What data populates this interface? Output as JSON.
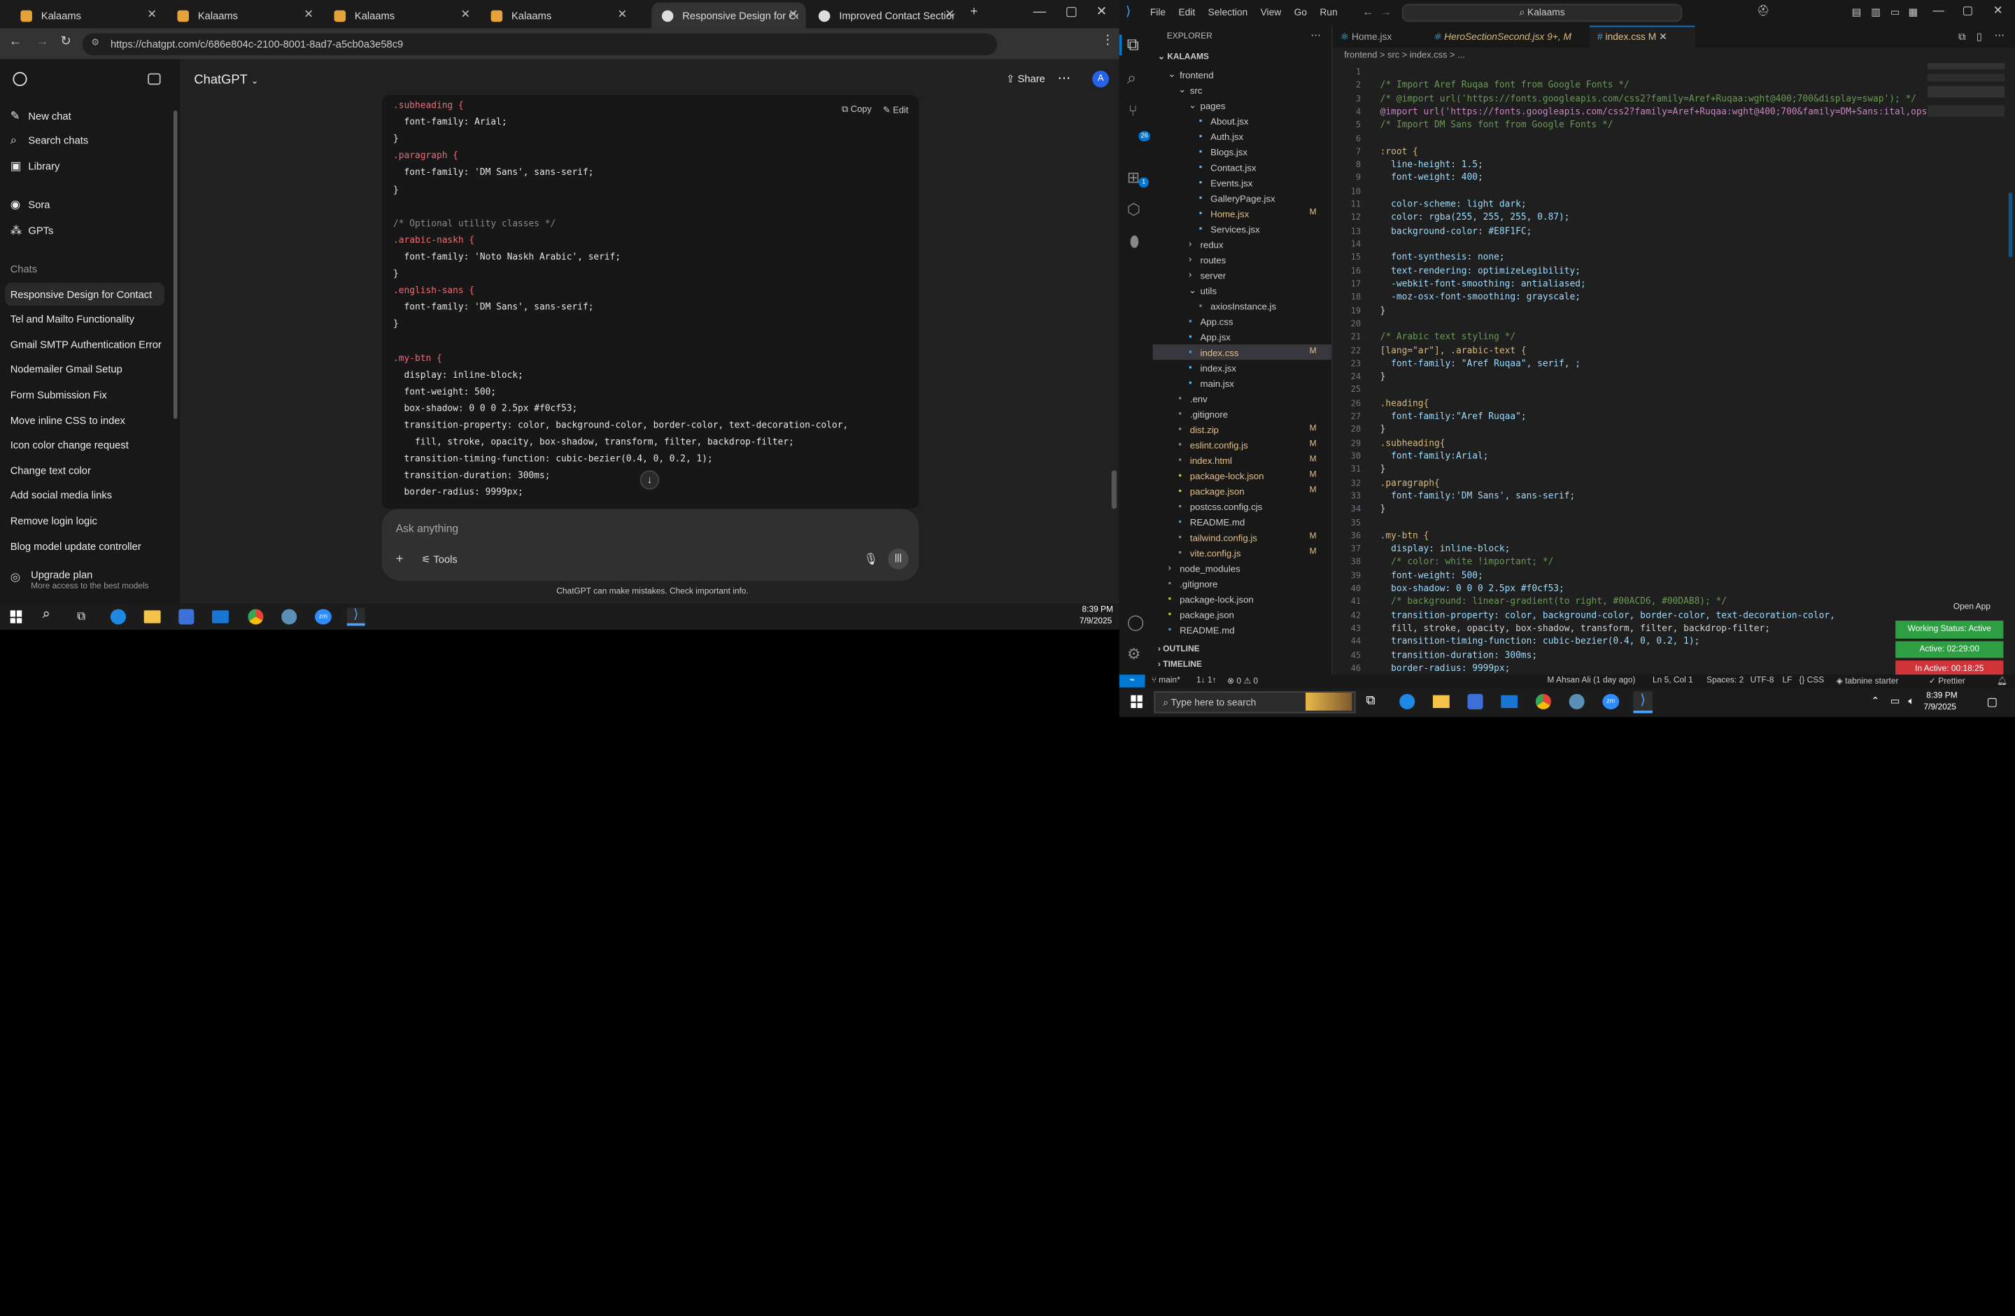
{
  "browser": {
    "tabs": [
      {
        "label": "Kalaams"
      },
      {
        "label": "Kalaams"
      },
      {
        "label": "Kalaams"
      },
      {
        "label": "Kalaams"
      },
      {
        "label": "Responsive Design for Conta"
      },
      {
        "label": "Improved Contact Section St"
      }
    ],
    "url": "https://chatgpt.com/c/686e804c-2100-8001-8ad7-a5cb0a3e58c9"
  },
  "chatgpt": {
    "brand": "ChatGPT",
    "share_label": "Share",
    "avatar": "A",
    "nav": [
      {
        "label": "New chat"
      },
      {
        "label": "Search chats"
      },
      {
        "label": "Library"
      },
      {
        "label": "Sora"
      },
      {
        "label": "GPTs"
      }
    ],
    "chats_heading": "Chats",
    "chats": [
      "Responsive Design for Contact",
      "Tel and Mailto Functionality",
      "Gmail SMTP Authentication Error",
      "Nodemailer Gmail Setup",
      "Form Submission Fix",
      "Move inline CSS to index",
      "Icon color change request",
      "Change text color",
      "Add social media links",
      "Remove login logic",
      "Blog model update controller"
    ],
    "upgrade_title": "Upgrade plan",
    "upgrade_sub": "More access to the best models",
    "copy_label": "Copy",
    "edit_label": "Edit",
    "ask_placeholder": "Ask anything",
    "tools_label": "Tools",
    "disclaimer": "ChatGPT can make mistakes. Check important info."
  },
  "code_lines": [
    ".subheading {",
    "  font-family: Arial;",
    "}",
    ".paragraph {",
    "  font-family: 'DM Sans', sans-serif;",
    "}",
    "",
    "/* Optional utility classes */",
    ".arabic-naskh {",
    "  font-family: 'Noto Naskh Arabic', serif;",
    "}",
    ".english-sans {",
    "  font-family: 'DM Sans', sans-serif;",
    "}",
    "",
    ".my-btn {",
    "  display: inline-block;",
    "  font-weight: 500;",
    "  box-shadow: 0 0 0 2.5px #f0cf53;",
    "  transition-property: color, background-color, border-color, text-decoration-color,",
    "    fill, stroke, opacity, box-shadow, transform, filter, backdrop-filter;",
    "  transition-timing-function: cubic-bezier(0.4, 0, 0.2, 1);",
    "  transition-duration: 300ms;",
    "  border-radius: 9999px;"
  ],
  "taskbar_left": {
    "time": "8:39 PM",
    "date": "7/9/2025"
  },
  "vscode": {
    "menu": [
      "File",
      "Edit",
      "Selection",
      "View",
      "Go",
      "Run"
    ],
    "search": "Kalaams",
    "tabs": [
      {
        "label": "Home.jsx"
      },
      {
        "label": "HeroSectionSecond.jsx",
        "status": "9+, M"
      },
      {
        "label": "index.css",
        "status": "M"
      }
    ],
    "breadcrumb": "frontend > src > index.css > ...",
    "explorer_title": "EXPLORER",
    "root": "KALAAMS",
    "tree": [
      {
        "label": "frontend",
        "indent": 1,
        "type": "folder-open"
      },
      {
        "label": "src",
        "indent": 2,
        "type": "folder-open"
      },
      {
        "label": "pages",
        "indent": 3,
        "type": "folder-open"
      },
      {
        "label": "About.jsx",
        "indent": 4,
        "type": "file"
      },
      {
        "label": "Auth.jsx",
        "indent": 4,
        "type": "file"
      },
      {
        "label": "Blogs.jsx",
        "indent": 4,
        "type": "file"
      },
      {
        "label": "Contact.jsx",
        "indent": 4,
        "type": "file"
      },
      {
        "label": "Events.jsx",
        "indent": 4,
        "type": "file"
      },
      {
        "label": "GalleryPage.jsx",
        "indent": 4,
        "type": "file"
      },
      {
        "label": "Home.jsx",
        "indent": 4,
        "type": "file",
        "badge": "M"
      },
      {
        "label": "Services.jsx",
        "indent": 4,
        "type": "file"
      },
      {
        "label": "redux",
        "indent": 3,
        "type": "folder"
      },
      {
        "label": "routes",
        "indent": 3,
        "type": "folder"
      },
      {
        "label": "server",
        "indent": 3,
        "type": "folder"
      },
      {
        "label": "utils",
        "indent": 3,
        "type": "folder-open"
      },
      {
        "label": "axiosInstance.js",
        "indent": 4,
        "type": "file"
      },
      {
        "label": "App.css",
        "indent": 3,
        "type": "file"
      },
      {
        "label": "App.jsx",
        "indent": 3,
        "type": "file"
      },
      {
        "label": "index.css",
        "indent": 3,
        "type": "file",
        "badge": "M",
        "selected": true
      },
      {
        "label": "index.jsx",
        "indent": 3,
        "type": "file"
      },
      {
        "label": "main.jsx",
        "indent": 3,
        "type": "file"
      },
      {
        "label": ".env",
        "indent": 2,
        "type": "file"
      },
      {
        "label": ".gitignore",
        "indent": 2,
        "type": "file"
      },
      {
        "label": "dist.zip",
        "indent": 2,
        "type": "file",
        "badge": "M"
      },
      {
        "label": "eslint.config.js",
        "indent": 2,
        "type": "file",
        "badge": "M"
      },
      {
        "label": "index.html",
        "indent": 2,
        "type": "file",
        "badge": "M"
      },
      {
        "label": "package-lock.json",
        "indent": 2,
        "type": "file",
        "badge": "M"
      },
      {
        "label": "package.json",
        "indent": 2,
        "type": "file",
        "badge": "M"
      },
      {
        "label": "postcss.config.cjs",
        "indent": 2,
        "type": "file"
      },
      {
        "label": "README.md",
        "indent": 2,
        "type": "file"
      },
      {
        "label": "tailwind.config.js",
        "indent": 2,
        "type": "file",
        "badge": "M"
      },
      {
        "label": "vite.config.js",
        "indent": 2,
        "type": "file",
        "badge": "M"
      },
      {
        "label": "node_modules",
        "indent": 1,
        "type": "folder"
      },
      {
        "label": ".gitignore",
        "indent": 1,
        "type": "file"
      },
      {
        "label": "package-lock.json",
        "indent": 1,
        "type": "file"
      },
      {
        "label": "package.json",
        "indent": 1,
        "type": "file"
      },
      {
        "label": "README.md",
        "indent": 1,
        "type": "file"
      }
    ],
    "outline": "OUTLINE",
    "timeline": "TIMELINE",
    "editor_lines": [
      {
        "n": 1,
        "t": ""
      },
      {
        "n": 2,
        "t": "/* Import Aref Ruqaa font from Google Fonts */"
      },
      {
        "n": 3,
        "t": "/* @import url('https://fonts.googleapis.com/css2?family=Aref+Ruqaa:wght@400;700&display=swap'); */"
      },
      {
        "n": 4,
        "t": "@import url('https://fonts.googleapis.com/css2?family=Aref+Ruqaa:wght@400;700&family=DM+Sans:ital,ops"
      },
      {
        "n": 5,
        "t": "/* Import DM Sans font from Google Fonts */"
      },
      {
        "n": 6,
        "t": ""
      },
      {
        "n": 7,
        "t": ":root {"
      },
      {
        "n": 8,
        "t": "  line-height: 1.5;"
      },
      {
        "n": 9,
        "t": "  font-weight: 400;"
      },
      {
        "n": 10,
        "t": ""
      },
      {
        "n": 11,
        "t": "  color-scheme: light dark;"
      },
      {
        "n": 12,
        "t": "  color: rgba(255, 255, 255, 0.87);"
      },
      {
        "n": 13,
        "t": "  background-color: #E8F1FC;"
      },
      {
        "n": 14,
        "t": ""
      },
      {
        "n": 15,
        "t": "  font-synthesis: none;"
      },
      {
        "n": 16,
        "t": "  text-rendering: optimizeLegibility;"
      },
      {
        "n": 17,
        "t": "  -webkit-font-smoothing: antialiased;"
      },
      {
        "n": 18,
        "t": "  -moz-osx-font-smoothing: grayscale;"
      },
      {
        "n": 19,
        "t": "}"
      },
      {
        "n": 20,
        "t": ""
      },
      {
        "n": 21,
        "t": "/* Arabic text styling */"
      },
      {
        "n": 22,
        "t": "[lang=\"ar\"], .arabic-text {"
      },
      {
        "n": 23,
        "t": "  font-family: \"Aref Ruqaa\", serif, ;"
      },
      {
        "n": 24,
        "t": "}"
      },
      {
        "n": 25,
        "t": ""
      },
      {
        "n": 26,
        "t": ".heading{"
      },
      {
        "n": 27,
        "t": "  font-family:\"Aref Ruqaa\";"
      },
      {
        "n": 28,
        "t": "}"
      },
      {
        "n": 29,
        "t": ".subheading{"
      },
      {
        "n": 30,
        "t": "  font-family:Arial;"
      },
      {
        "n": 31,
        "t": "}"
      },
      {
        "n": 32,
        "t": ".paragraph{"
      },
      {
        "n": 33,
        "t": "  font-family:'DM Sans', sans-serif;"
      },
      {
        "n": 34,
        "t": "}"
      },
      {
        "n": 35,
        "t": ""
      },
      {
        "n": 36,
        "t": ".my-btn {"
      },
      {
        "n": 37,
        "t": "  display: inline-block;"
      },
      {
        "n": 38,
        "t": "  /* color: white !important; */"
      },
      {
        "n": 39,
        "t": "  font-weight: 500;"
      },
      {
        "n": 40,
        "t": "  box-shadow: 0 0 0 2.5px #f0cf53;"
      },
      {
        "n": 41,
        "t": "  /* background: linear-gradient(to right, #00ACD6, #00DAB8); */"
      },
      {
        "n": 42,
        "t": "  transition-property: color, background-color, border-color, text-decoration-color,"
      },
      {
        "n": 43,
        "t": "  fill, stroke, opacity, box-shadow, transform, filter, backdrop-filter;"
      },
      {
        "n": 44,
        "t": "  transition-timing-function: cubic-bezier(0.4, 0, 0.2, 1);"
      },
      {
        "n": 45,
        "t": "  transition-duration: 300ms;"
      },
      {
        "n": 46,
        "t": "  border-radius: 9999px;"
      }
    ],
    "open_app": "Open App",
    "working_status": "Working Status: Active",
    "active_time": "Active: 02:29:00",
    "inactive_time": "In Active: 00:18:25",
    "status": {
      "branch": "main*",
      "sync": "1↓ 1↑",
      "problems": "⊗ 0 ⚠ 0",
      "blame": "M Ahsan Ali (1 day ago)",
      "position": "Ln 5, Col 1",
      "spaces": "Spaces: 2",
      "encoding": "UTF-8",
      "eol": "LF",
      "language": "CSS",
      "tabnine": "tabnine starter",
      "prettier": "Prettier"
    }
  },
  "taskbar_right": {
    "search_placeholder": "Type here to search",
    "time": "8:39 PM",
    "date": "7/9/2025"
  },
  "colors": {
    "chat_bg": "#212121",
    "sidebar_bg": "#181818",
    "vscode_bg": "#1f1f1f",
    "accent_blue": "#0078d4",
    "working_green": "#2ea043",
    "inactive_red": "#d13438"
  }
}
